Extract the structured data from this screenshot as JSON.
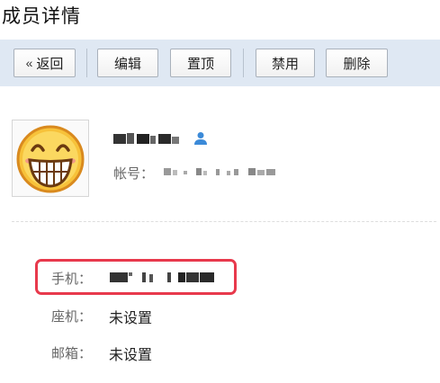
{
  "page": {
    "title": "成员详情"
  },
  "toolbar": {
    "back_icon": "«",
    "back_label": "返回",
    "edit_label": "编辑",
    "pin_label": "置顶",
    "disable_label": "禁用",
    "delete_label": "删除"
  },
  "member": {
    "avatar_icon": "grinning-face-emoji",
    "account_label": "帐号："
  },
  "contact": {
    "phone_label": "手机：",
    "landline_label": "座机：",
    "landline_value": "未设置",
    "email_label": "邮箱：",
    "email_value": "未设置"
  },
  "colors": {
    "toolbar_bg": "#dfe8f3",
    "highlight": "#e8394c",
    "user_icon": "#3b8ad8"
  }
}
